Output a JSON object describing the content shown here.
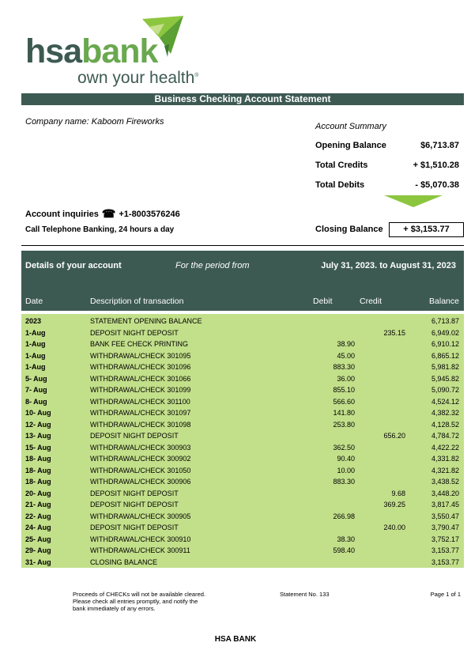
{
  "logo": {
    "brand_hsa": "hsa",
    "brand_bank": "bank",
    "tagline": "own your health",
    "registered": "®",
    "colors": {
      "dark": "#3d5a52",
      "green": "#6aa84f",
      "light_green": "#8cc63f"
    }
  },
  "title": "Business Checking Account Statement",
  "company": "Company name: Kaboom Fireworks",
  "summary": {
    "heading": "Account Summary",
    "opening_label": "Opening Balance",
    "opening_value": "$6,713.87",
    "credits_label": "Total Credits",
    "credits_value": "+ $1,510.28",
    "debits_label": "Total Debits",
    "debits_value": "- $5,070.38",
    "closing_label": "Closing Balance",
    "closing_value": "+ $3,153.77"
  },
  "contact": {
    "inquiries_label": "Account inquiries",
    "phone_icon": "telephone-icon",
    "phone": "+1-8003576246",
    "telephone_banking": "Call Telephone Banking, 24 hours a day"
  },
  "details": {
    "title": "Details of your account",
    "period_label": "For the period from",
    "period_range": "July 31, 2023. to August 31, 2023",
    "columns": [
      "Date",
      "Description of transaction",
      "Debit",
      "Credit",
      "Balance"
    ]
  },
  "transactions": [
    {
      "date": "2023",
      "desc": "STATEMENT OPENING BALANCE",
      "debit": "",
      "credit": "",
      "balance": "6,713.87"
    },
    {
      "date": "1-Aug",
      "desc": "DEPOSIT NIGHT DEPOSIT",
      "debit": "",
      "credit": "235.15",
      "balance": "6,949.02"
    },
    {
      "date": "1-Aug",
      "desc": "BANK FEE CHECK PRINTING",
      "debit": "38.90",
      "credit": "",
      "balance": "6,910.12"
    },
    {
      "date": "1-Aug",
      "desc": "WITHDRAWAL/CHECK 301095",
      "debit": "45.00",
      "credit": "",
      "balance": "6,865.12"
    },
    {
      "date": "1-Aug",
      "desc": "WITHDRAWAL/CHECK 301096",
      "debit": "883.30",
      "credit": "",
      "balance": "5,981.82"
    },
    {
      "date": "5- Aug",
      "desc": "WITHDRAWAL/CHECK 301066",
      "debit": "36.00",
      "credit": "",
      "balance": "5,945.82"
    },
    {
      "date": "7- Aug",
      "desc": "WITHDRAWAL/CHECK 301099",
      "debit": "855.10",
      "credit": "",
      "balance": "5,090.72"
    },
    {
      "date": "8- Aug",
      "desc": "WITHDRAWAL/CHECK 301100",
      "debit": "566.60",
      "credit": "",
      "balance": "4,524.12"
    },
    {
      "date": "10- Aug",
      "desc": "WITHDRAWAL/CHECK 301097",
      "debit": "141.80",
      "credit": "",
      "balance": "4,382.32"
    },
    {
      "date": "12- Aug",
      "desc": "WITHDRAWAL/CHECK 301098",
      "debit": "253.80",
      "credit": "",
      "balance": "4,128.52"
    },
    {
      "date": "13- Aug",
      "desc": "DEPOSIT NIGHT DEPOSIT",
      "debit": "",
      "credit": "656.20",
      "balance": "4,784.72"
    },
    {
      "date": "15- Aug",
      "desc": "WITHDRAWAL/CHECK 300903",
      "debit": "362.50",
      "credit": "",
      "balance": "4,422.22"
    },
    {
      "date": "18- Aug",
      "desc": "WITHDRAWAL/CHECK 300902",
      "debit": "90.40",
      "credit": "",
      "balance": "4,331.82"
    },
    {
      "date": "18- Aug",
      "desc": "WITHDRAWAL/CHECK 301050",
      "debit": "10.00",
      "credit": "",
      "balance": "4,321.82"
    },
    {
      "date": "18- Aug",
      "desc": "WITHDRAWAL/CHECK 300906",
      "debit": "883.30",
      "credit": "",
      "balance": "3,438.52"
    },
    {
      "date": "20- Aug",
      "desc": "DEPOSIT NIGHT DEPOSIT",
      "debit": "",
      "credit": "9.68",
      "balance": "3,448.20"
    },
    {
      "date": "21- Aug",
      "desc": "DEPOSIT NIGHT DEPOSIT",
      "debit": "",
      "credit": "369.25",
      "balance": "3,817.45"
    },
    {
      "date": "22- Aug",
      "desc": "WITHDRAWAL/CHECK 300905",
      "debit": "266.98",
      "credit": "",
      "balance": "3,550.47"
    },
    {
      "date": "24- Aug",
      "desc": "DEPOSIT NIGHT DEPOSIT",
      "debit": "",
      "credit": "240.00",
      "balance": "3,790.47"
    },
    {
      "date": "25- Aug",
      "desc": "WITHDRAWAL/CHECK 300910",
      "debit": "38.30",
      "credit": "",
      "balance": "3,752.17"
    },
    {
      "date": "29- Aug",
      "desc": "WITHDRAWAL/CHECK 300911",
      "debit": "598.40",
      "credit": "",
      "balance": "3,153.77"
    },
    {
      "date": "31- Aug",
      "desc": "CLOSING BALANCE",
      "debit": "",
      "credit": "",
      "balance": "3,153.77"
    }
  ],
  "footer": {
    "notice": "Proceeds of CHECKs will not be available cleared. Please check all entries promptly, and notify the bank immediately of any errors.",
    "statement_no": "Statement No. 133",
    "page": "Page 1 of 1",
    "bank": "HSA BANK"
  }
}
